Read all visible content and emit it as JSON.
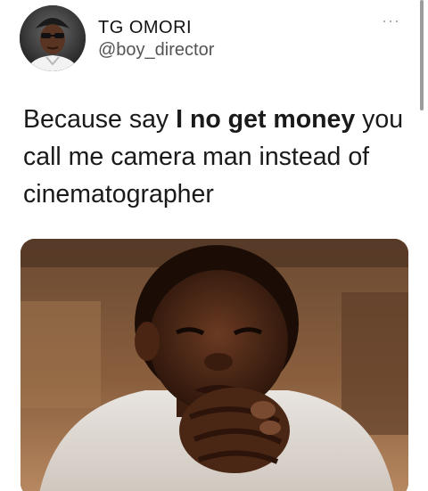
{
  "author": {
    "display_name": "TG OMORI",
    "handle": "@boy_director"
  },
  "menu": {
    "icon": "more-horizontal-icon",
    "glyph": "···"
  },
  "tweet": {
    "text_part1": "Because say ",
    "text_bold": "I no get money",
    "text_part2": " you call me camera man instead of cinematographer"
  },
  "colors": {
    "background": "#ffffff",
    "text": "#0f1419",
    "secondary": "#545454",
    "menu_dots": "#9aa3ab"
  }
}
